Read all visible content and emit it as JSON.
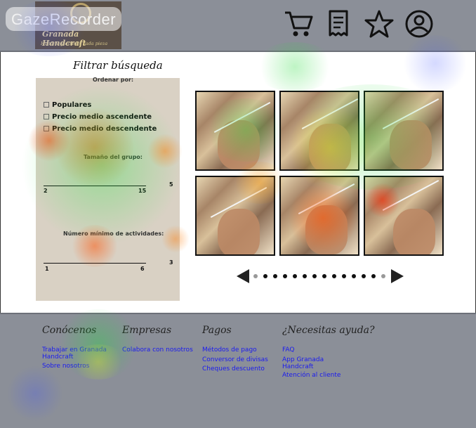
{
  "overlay": {
    "badge_text": "GazeRecorder"
  },
  "header": {
    "logo": {
      "title": "Granada Handcraft",
      "tagline": "Historia y arte en cada pieza"
    },
    "icons": [
      "cart-icon",
      "receipt-icon",
      "star-icon",
      "user-icon"
    ]
  },
  "filters": {
    "title": "Filtrar búsqueda",
    "sort_title": "Ordenar por:",
    "sort_options": [
      "Populares",
      "Precio medio ascendente",
      "Precio medio descendente"
    ],
    "group_size_title": "Tamaño del grupo:",
    "group_min": "2",
    "group_max": "15",
    "group_value": "5",
    "activities_title": "Número mínimo de actividades:",
    "act_min": "1",
    "act_max": "6",
    "act_value": "3"
  },
  "gallery": {
    "images": 6,
    "carousel_dots": 14,
    "active_dot": 0
  },
  "footer": {
    "columns": [
      {
        "heading": "Conócenos",
        "links": [
          "Trabajar en Granada Handcraft",
          "Sobre nosotros"
        ]
      },
      {
        "heading": "Empresas",
        "links": [
          "Colabora con nosotros"
        ]
      },
      {
        "heading": "Pagos",
        "links": [
          "Métodos de pago",
          "Conversor de divisas",
          "Cheques descuento"
        ]
      },
      {
        "heading": "¿Necesitas ayuda?",
        "links": [
          "FAQ",
          "App Granada Handcraft",
          "Atención al cliente"
        ]
      }
    ]
  },
  "colors": {
    "bar": "#8b8f98",
    "sidebar": "#d9d1c4",
    "link": "#1a1af0"
  }
}
